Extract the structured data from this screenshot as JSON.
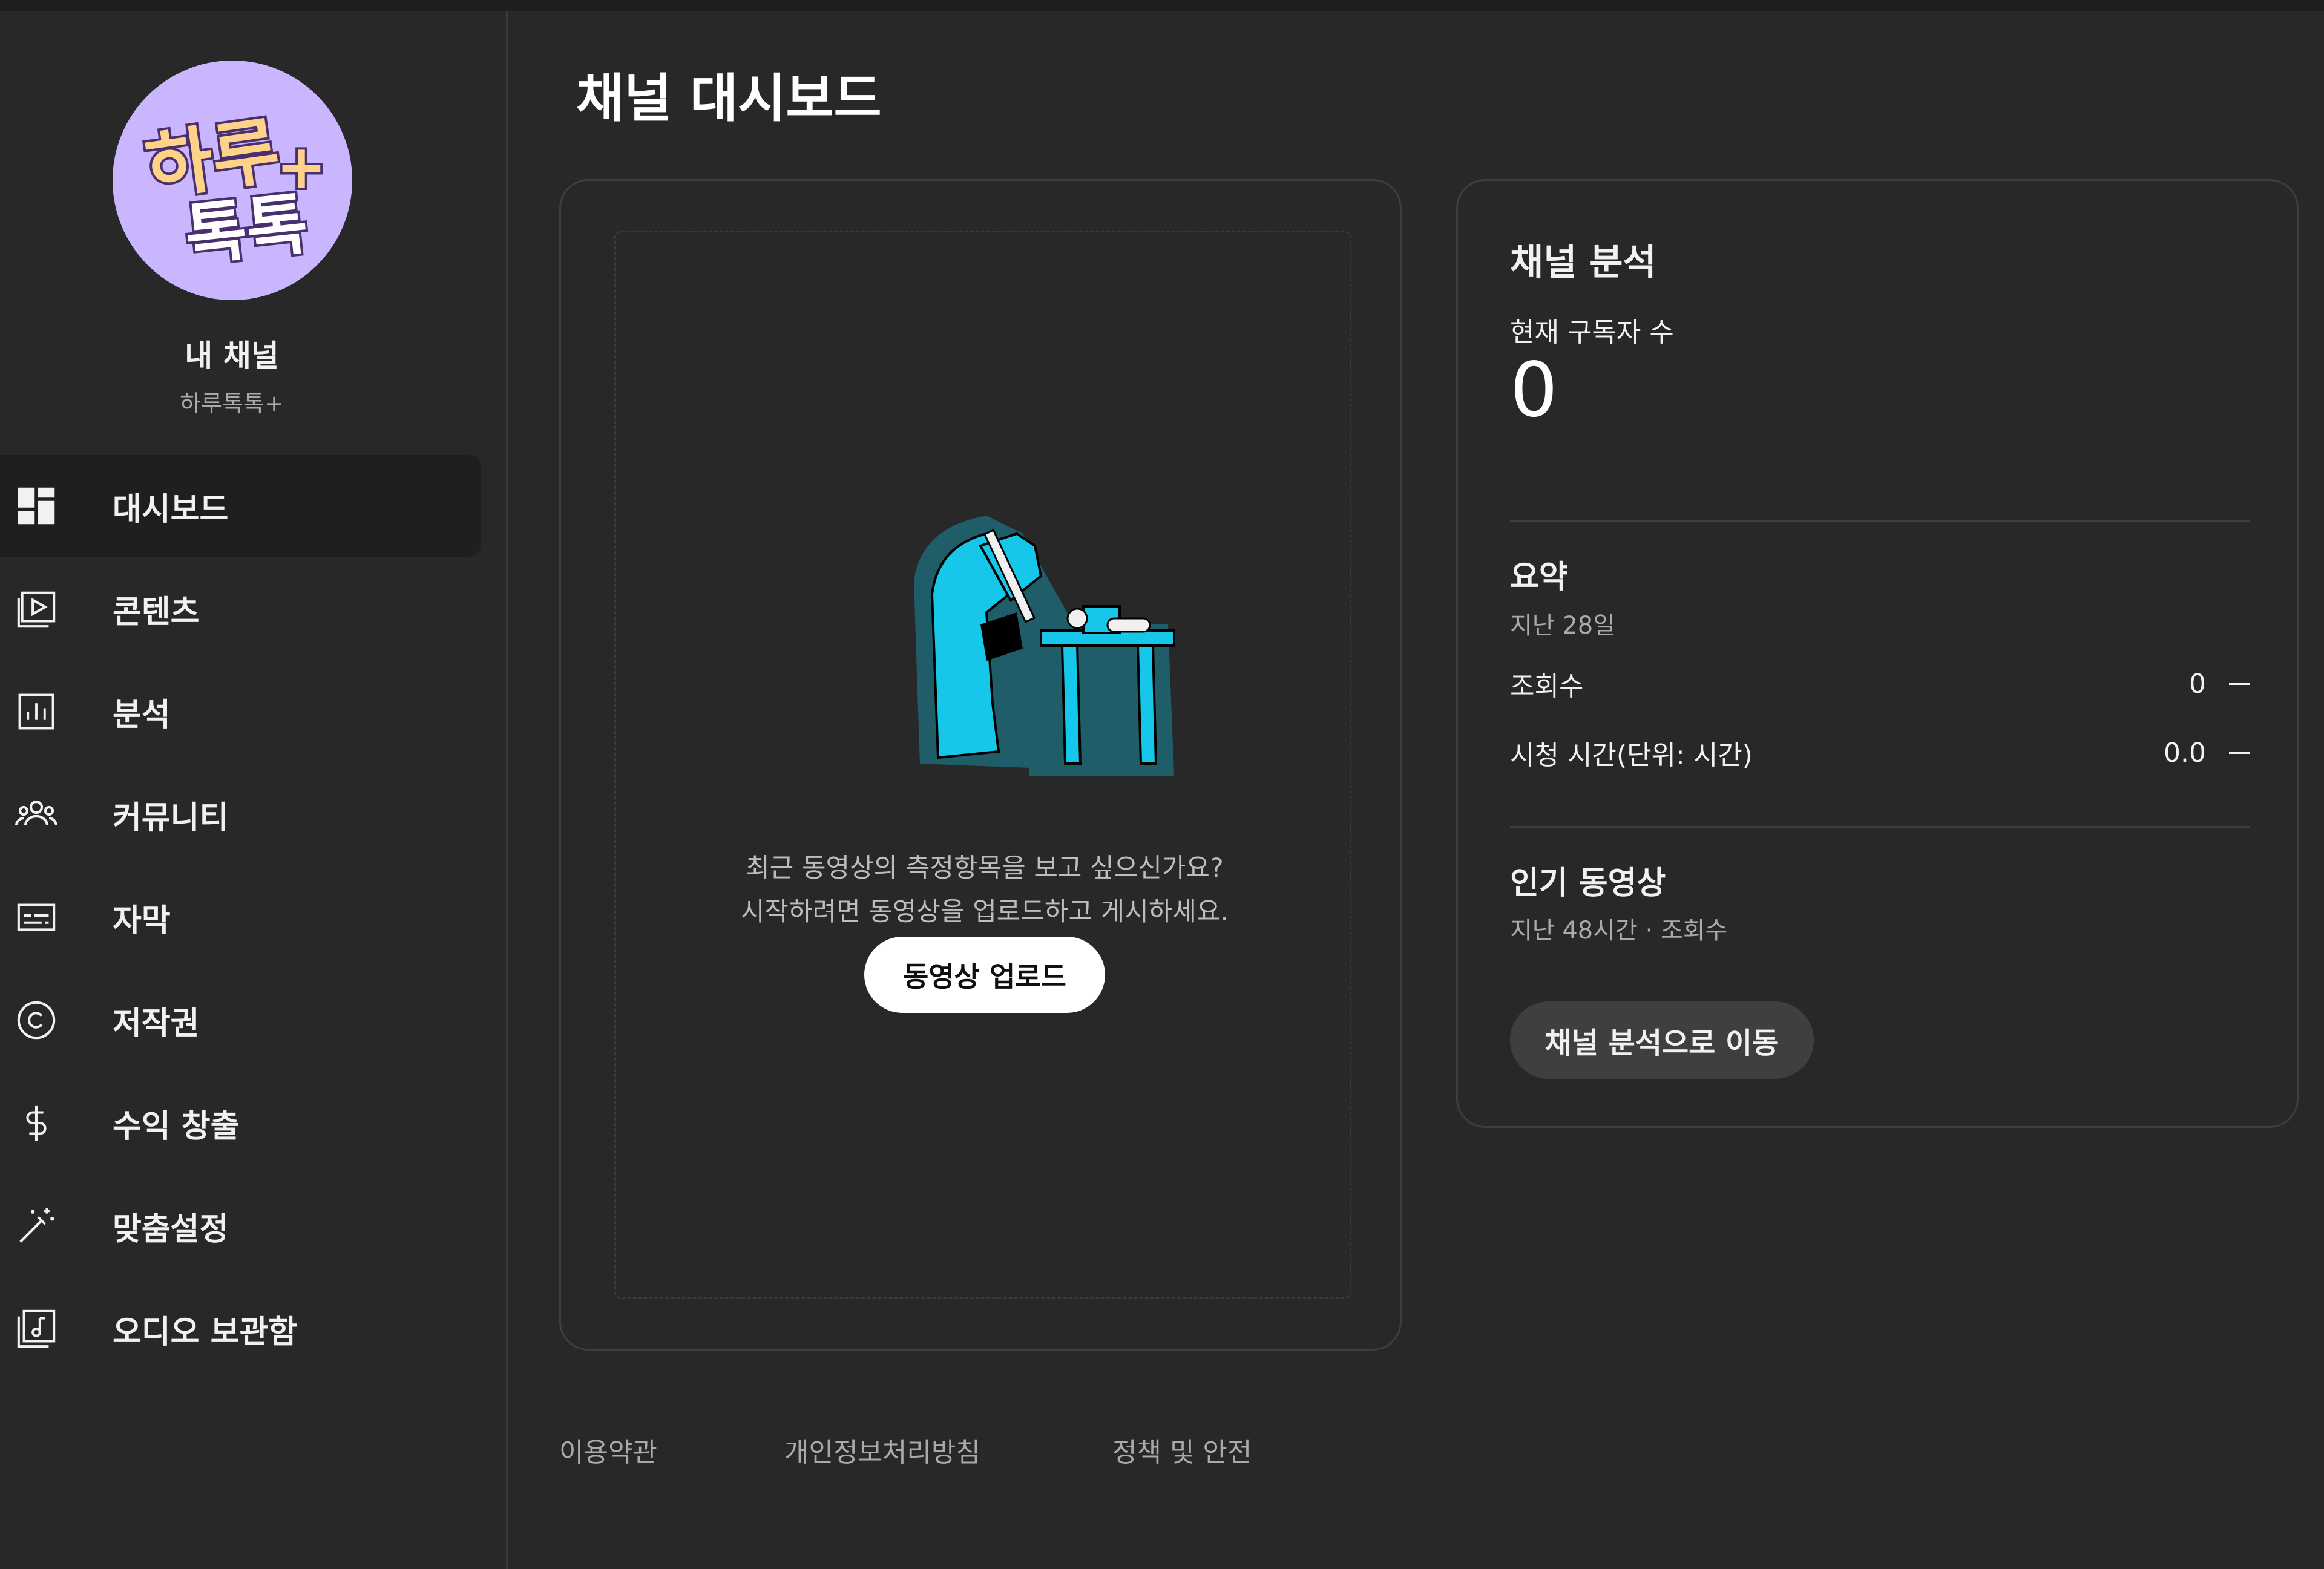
{
  "page": {
    "title": "채널 대시보드"
  },
  "sidebar": {
    "avatar": {
      "text_main": "하루",
      "text_sub": "톡톡",
      "text_plus": "+"
    },
    "channel_title": "내 채널",
    "channel_handle": "하루톡톡+",
    "items": [
      {
        "label": "대시보드",
        "icon": "dashboard-icon",
        "active": true
      },
      {
        "label": "콘텐츠",
        "icon": "content-icon"
      },
      {
        "label": "분석",
        "icon": "analytics-icon"
      },
      {
        "label": "커뮤니티",
        "icon": "community-icon"
      },
      {
        "label": "자막",
        "icon": "subtitles-icon"
      },
      {
        "label": "저작권",
        "icon": "copyright-icon"
      },
      {
        "label": "수익 창출",
        "icon": "monetization-icon"
      },
      {
        "label": "맞춤설정",
        "icon": "customization-icon"
      },
      {
        "label": "오디오 보관함",
        "icon": "audio-library-icon"
      }
    ]
  },
  "upload_card": {
    "line1": "최근 동영상의 측정항목을 보고 싶으신가요?",
    "line2": "시작하려면 동영상을 업로드하고 게시하세요.",
    "button": "동영상 업로드"
  },
  "analytics_card": {
    "title": "채널 분석",
    "subscribers_label": "현재 구독자 수",
    "subscribers_value": "0",
    "summary_title": "요약",
    "summary_period": "지난 28일",
    "metrics": [
      {
        "label": "조회수",
        "value": "0"
      },
      {
        "label": "시청 시간(단위: 시간)",
        "value": "0.0"
      }
    ],
    "top_videos_title": "인기 동영상",
    "top_videos_period": "지난 48시간 · 조회수",
    "button": "채널 분석으로 이동"
  },
  "footer": {
    "links": [
      "이용약관",
      "개인정보처리방침",
      "정책 및 안전"
    ]
  },
  "colors": {
    "background": "#282828",
    "active_nav": "#1f1f1f",
    "avatar_bg": "#c9b6ff",
    "illustration_cyan": "#17c7ea",
    "illustration_teal": "#1f5e68"
  }
}
